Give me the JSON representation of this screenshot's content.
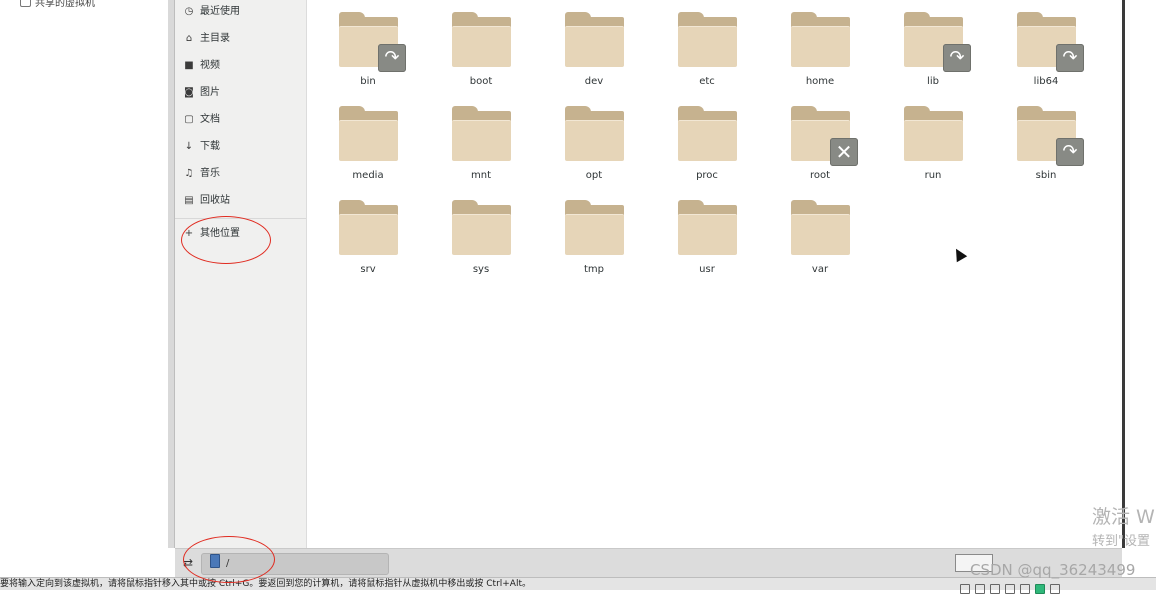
{
  "library": {
    "shared_label": "共享的虚拟机"
  },
  "places": [
    {
      "icon": "clock-icon",
      "glyph": "◷",
      "label": "最近使用"
    },
    {
      "icon": "home-icon",
      "glyph": "⌂",
      "label": "主目录"
    },
    {
      "icon": "video-icon",
      "glyph": "■",
      "label": "视频"
    },
    {
      "icon": "camera-icon",
      "glyph": "◙",
      "label": "图片"
    },
    {
      "icon": "document-icon",
      "glyph": "▢",
      "label": "文档"
    },
    {
      "icon": "download-icon",
      "glyph": "↓",
      "label": "下载"
    },
    {
      "icon": "music-icon",
      "glyph": "♫",
      "label": "音乐"
    },
    {
      "icon": "trash-icon",
      "glyph": "▤",
      "label": "回收站"
    }
  ],
  "other_locations": {
    "icon": "plus-icon",
    "glyph": "+",
    "label": "其他位置"
  },
  "files": [
    {
      "name": "bin",
      "emblem": "symlink"
    },
    {
      "name": "boot",
      "emblem": ""
    },
    {
      "name": "dev",
      "emblem": ""
    },
    {
      "name": "etc",
      "emblem": ""
    },
    {
      "name": "home",
      "emblem": ""
    },
    {
      "name": "lib",
      "emblem": "symlink"
    },
    {
      "name": "lib64",
      "emblem": "symlink"
    },
    {
      "name": "media",
      "emblem": ""
    },
    {
      "name": "mnt",
      "emblem": ""
    },
    {
      "name": "opt",
      "emblem": ""
    },
    {
      "name": "proc",
      "emblem": ""
    },
    {
      "name": "root",
      "emblem": "noaccess"
    },
    {
      "name": "run",
      "emblem": ""
    },
    {
      "name": "sbin",
      "emblem": "symlink"
    },
    {
      "name": "srv",
      "emblem": ""
    },
    {
      "name": "sys",
      "emblem": ""
    },
    {
      "name": "tmp",
      "emblem": ""
    },
    {
      "name": "usr",
      "emblem": ""
    },
    {
      "name": "var",
      "emblem": ""
    }
  ],
  "pathbar": {
    "root_label": "/"
  },
  "status": {
    "message": "要将输入定向到该虚拟机，请将鼠标指针移入其中或按 Ctrl+G。要返回到您的计算机，请将鼠标指针从虚拟机中移出或按 Ctrl+Alt。"
  },
  "overlay": {
    "activate_line1": "激活 W",
    "activate_line2": "转到\"设置",
    "watermark": "CSDN @qq_36243499"
  },
  "colors": {
    "folder_front": "#e6d5b8",
    "folder_back": "#c6b28f",
    "emblem": "#888a85",
    "annotation": "#e02b20"
  }
}
